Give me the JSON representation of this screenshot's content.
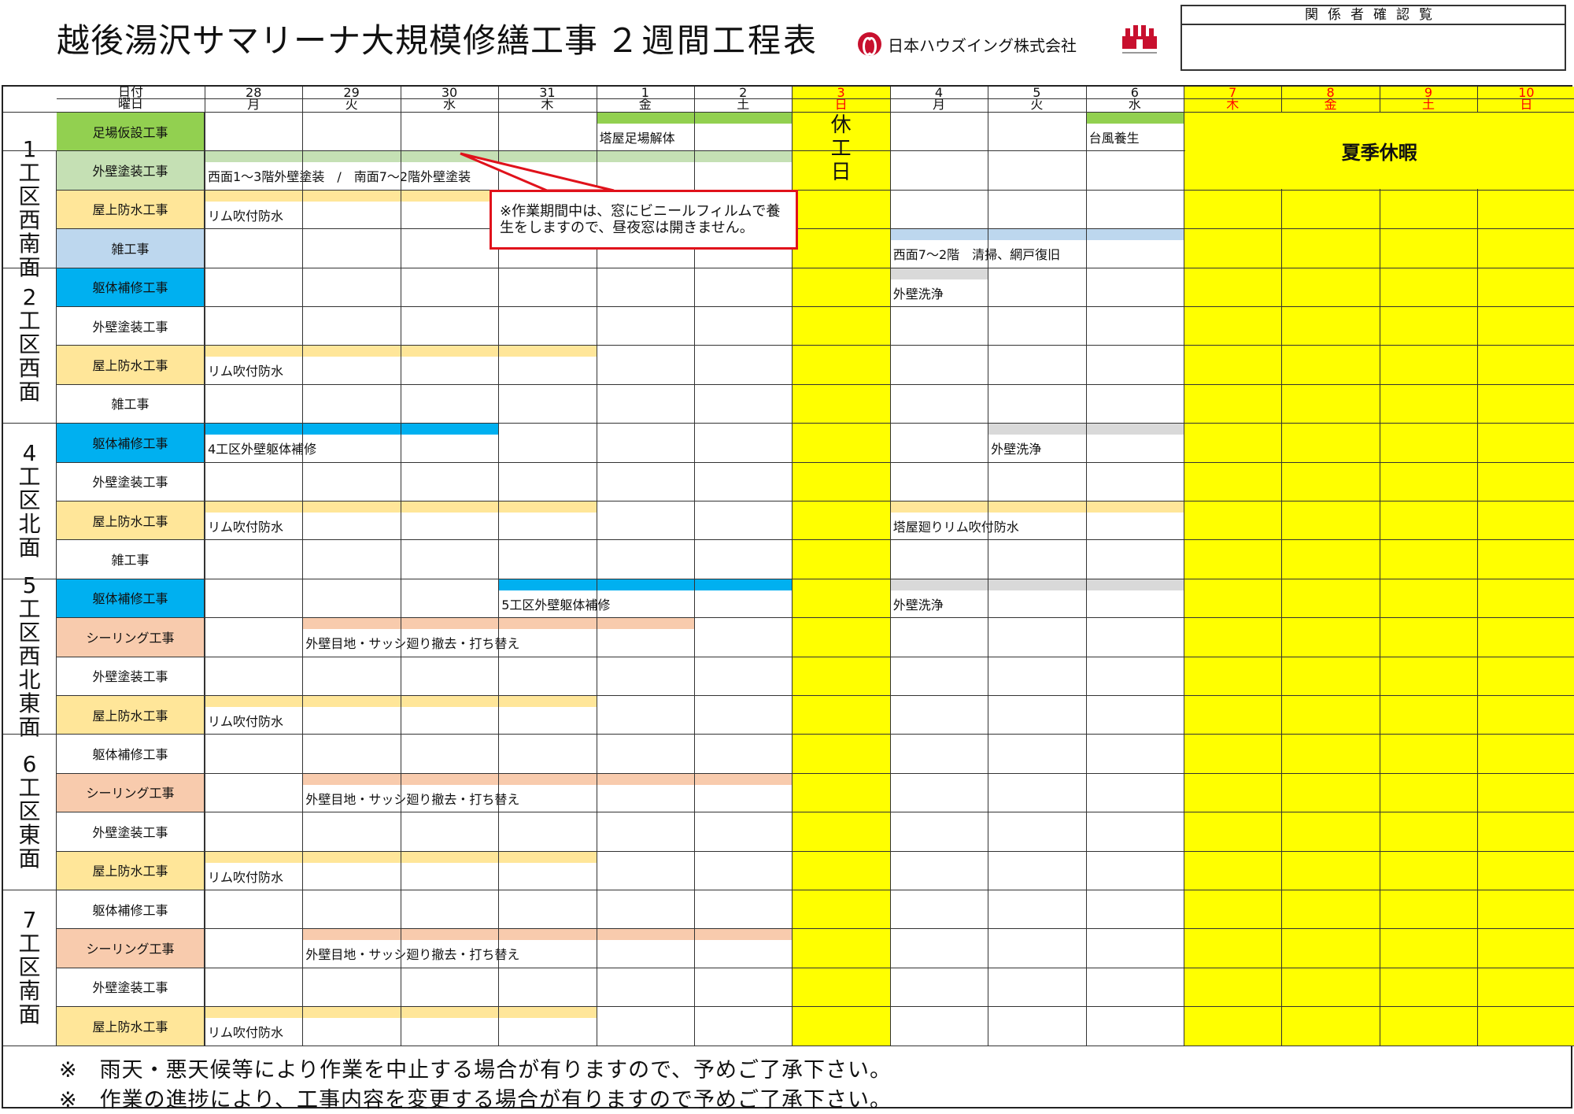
{
  "header": {
    "title": "越後湯沢サマリーナ大規模修繕工事",
    "subtitle": "２週間工程表",
    "company": "日本ハウズイング株式会社",
    "confirm_label": "関係者確認覧"
  },
  "columns": {
    "date_label": "日付",
    "weekday_label": "曜日",
    "days": [
      {
        "date": "28",
        "wd": "月",
        "red": false
      },
      {
        "date": "29",
        "wd": "火",
        "red": false
      },
      {
        "date": "30",
        "wd": "水",
        "red": false
      },
      {
        "date": "31",
        "wd": "木",
        "red": false
      },
      {
        "date": "1",
        "wd": "金",
        "red": false
      },
      {
        "date": "2",
        "wd": "土",
        "red": false
      },
      {
        "date": "3",
        "wd": "日",
        "red": true
      },
      {
        "date": "4",
        "wd": "月",
        "red": false
      },
      {
        "date": "5",
        "wd": "火",
        "red": false
      },
      {
        "date": "6",
        "wd": "水",
        "red": false
      },
      {
        "date": "7",
        "wd": "木",
        "red": true
      },
      {
        "date": "8",
        "wd": "金",
        "red": true
      },
      {
        "date": "9",
        "wd": "土",
        "red": true
      },
      {
        "date": "10",
        "wd": "日",
        "red": true
      }
    ]
  },
  "groups": [
    {
      "label": "1工区西南面",
      "rows": [
        1,
        2,
        3
      ]
    },
    {
      "label": "2工区西面",
      "rows": [
        4,
        5,
        6,
        7
      ]
    },
    {
      "label": "4工区北面",
      "rows": [
        8,
        9,
        10,
        11
      ]
    },
    {
      "label": "5工区西北東面",
      "rows": [
        12,
        13,
        14,
        15
      ]
    },
    {
      "label": "6工区東面",
      "rows": [
        16,
        17,
        18,
        19
      ]
    },
    {
      "label": "7工区南面",
      "rows": [
        20,
        21,
        22,
        23
      ]
    }
  ],
  "rows": [
    {
      "name": "足場仮設工事",
      "color": "#92d050"
    },
    {
      "name": "外壁塗装工事",
      "color": "#c5e0b4"
    },
    {
      "name": "屋上防水工事",
      "color": "#ffe699"
    },
    {
      "name": "雑工事",
      "color": "#bdd7ee"
    },
    {
      "name": "躯体補修工事",
      "color": "#00b0f0"
    },
    {
      "name": "外壁塗装工事",
      "color": "#ffffff"
    },
    {
      "name": "屋上防水工事",
      "color": "#ffe699"
    },
    {
      "name": "雑工事",
      "color": "#ffffff"
    },
    {
      "name": "躯体補修工事",
      "color": "#00b0f0"
    },
    {
      "name": "外壁塗装工事",
      "color": "#ffffff"
    },
    {
      "name": "屋上防水工事",
      "color": "#ffe699"
    },
    {
      "name": "雑工事",
      "color": "#ffffff"
    },
    {
      "name": "躯体補修工事",
      "color": "#00b0f0"
    },
    {
      "name": "シーリング工事",
      "color": "#f8cbad"
    },
    {
      "name": "外壁塗装工事",
      "color": "#ffffff"
    },
    {
      "name": "屋上防水工事",
      "color": "#ffe699"
    },
    {
      "name": "躯体補修工事",
      "color": "#ffffff"
    },
    {
      "name": "シーリング工事",
      "color": "#f8cbad"
    },
    {
      "name": "外壁塗装工事",
      "color": "#ffffff"
    },
    {
      "name": "屋上防水工事",
      "color": "#ffe699"
    },
    {
      "name": "躯体補修工事",
      "color": "#ffffff"
    },
    {
      "name": "シーリング工事",
      "color": "#f8cbad"
    },
    {
      "name": "外壁塗装工事",
      "color": "#ffffff"
    },
    {
      "name": "屋上防水工事",
      "color": "#ffe699"
    }
  ],
  "bars": [
    {
      "row": 0,
      "start": 4,
      "end": 6,
      "color": "#92d050",
      "label": "塔屋足場解体"
    },
    {
      "row": 0,
      "start": 9,
      "end": 10,
      "color": "#92d050",
      "label": "台風養生"
    },
    {
      "row": 1,
      "start": 0,
      "end": 6,
      "color": "#c5e0b4",
      "label": "西面1～3階外壁塗装　/　南面7～2階外壁塗装"
    },
    {
      "row": 2,
      "start": 0,
      "end": 4,
      "color": "#ffe699",
      "label": "リム吹付防水"
    },
    {
      "row": 3,
      "start": 7,
      "end": 10,
      "color": "#bdd7ee",
      "label": "西面7～2階　清掃、網戸復旧"
    },
    {
      "row": 4,
      "start": 7,
      "end": 8,
      "color": "#d9d9d9",
      "label": "外壁洗浄"
    },
    {
      "row": 6,
      "start": 0,
      "end": 4,
      "color": "#ffe699",
      "label": "リム吹付防水"
    },
    {
      "row": 8,
      "start": 0,
      "end": 3,
      "color": "#00b0f0",
      "label": "4工区外壁躯体補修"
    },
    {
      "row": 8,
      "start": 8,
      "end": 10,
      "color": "#d9d9d9",
      "label": "外壁洗浄"
    },
    {
      "row": 10,
      "start": 0,
      "end": 4,
      "color": "#ffe699",
      "label": "リム吹付防水"
    },
    {
      "row": 10,
      "start": 7,
      "end": 10,
      "color": "#ffe699",
      "label": "塔屋廻りリム吹付防水"
    },
    {
      "row": 12,
      "start": 3,
      "end": 6,
      "color": "#00b0f0",
      "label": "5工区外壁躯体補修"
    },
    {
      "row": 12,
      "start": 7,
      "end": 10,
      "color": "#d9d9d9",
      "label": "外壁洗浄"
    },
    {
      "row": 13,
      "start": 1,
      "end": 5,
      "color": "#f8cbad",
      "label": "外壁目地・サッシ廻り撤去・打ち替え"
    },
    {
      "row": 15,
      "start": 0,
      "end": 4,
      "color": "#ffe699",
      "label": "リム吹付防水"
    },
    {
      "row": 17,
      "start": 1,
      "end": 6,
      "color": "#f8cbad",
      "label": "外壁目地・サッシ廻り撤去・打ち替え"
    },
    {
      "row": 19,
      "start": 0,
      "end": 4,
      "color": "#ffe699",
      "label": "リム吹付防水"
    },
    {
      "row": 21,
      "start": 1,
      "end": 6,
      "color": "#f8cbad",
      "label": "外壁目地・サッシ廻り撤去・打ち替え"
    },
    {
      "row": 23,
      "start": 0,
      "end": 4,
      "color": "#ffe699",
      "label": "リム吹付防水"
    }
  ],
  "holiday_label": "休工日",
  "summer_label": "夏季休暇",
  "callout": "※作業期間中は、窓にビニールフィルムで養生をしますので、昼夜窓は開きません。",
  "notes": [
    "※　雨天・悪天候等により作業を中止する場合が有りますので、予めご了承下さい。",
    "※　作業の進捗により、工事内容を変更する場合が有りますので予めご了承下さい。"
  ],
  "colors": {
    "holiday": "#ffff00",
    "red": "#ff0000",
    "callout_border": "#e0121b"
  }
}
